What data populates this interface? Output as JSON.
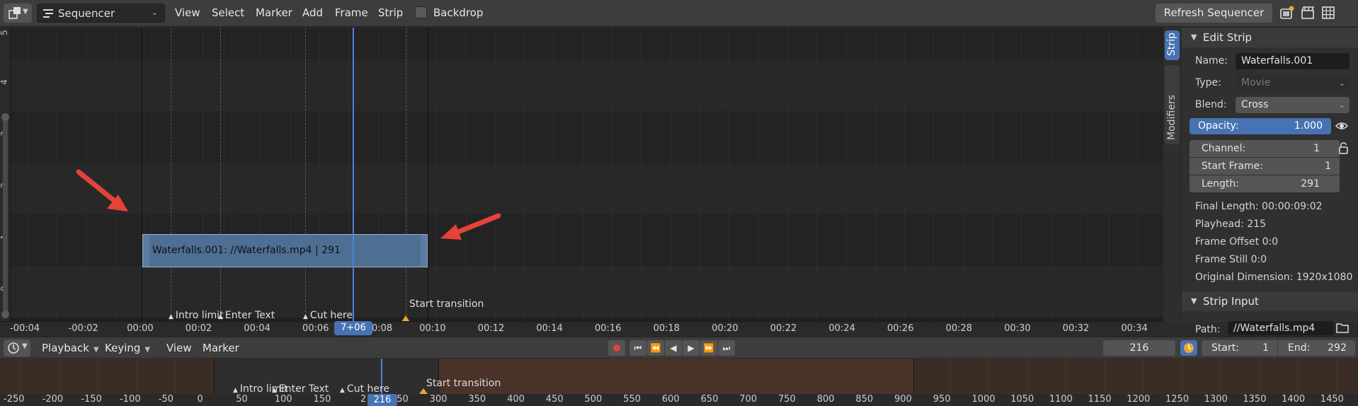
{
  "header": {
    "view_type": "Sequencer",
    "menus": [
      "View",
      "Select",
      "Marker",
      "Add",
      "Frame",
      "Strip"
    ],
    "backdrop_label": "Backdrop",
    "refresh_label": "Refresh Sequencer"
  },
  "sequencer": {
    "channels": [
      "5",
      "4",
      "3",
      "2",
      "1",
      "0"
    ],
    "strip_label": "Waterfalls.001: //Waterfalls.mp4 | 291",
    "markers": [
      "Intro limit",
      "Enter Text",
      "Cut here"
    ],
    "transition_marker": "Start transition",
    "time_labels": [
      "-00:04",
      "-00:02",
      "00:00",
      "00:02",
      "00:04",
      "00:06",
      "0:08",
      "00:10",
      "00:12",
      "00:14",
      "00:16",
      "00:18",
      "00:20",
      "00:22",
      "00:24",
      "00:26",
      "00:28",
      "00:30",
      "00:32",
      "00:34"
    ],
    "current_time": "7+06",
    "annotation_arrow_color": "#e5433a",
    "strip_color": "#4f6e93",
    "playhead_color": "#4c82d6"
  },
  "side_tabs": {
    "strip": "Strip",
    "modifiers": "Modifiers"
  },
  "edit_strip": {
    "title": "Edit Strip",
    "name_label": "Name:",
    "name_value": "Waterfalls.001",
    "type_label": "Type:",
    "type_value": "Movie",
    "blend_label": "Blend:",
    "blend_value": "Cross",
    "opacity_label": "Opacity:",
    "opacity_value": "1.000",
    "channel_label": "Channel:",
    "channel_value": "1",
    "start_frame_label": "Start Frame:",
    "start_frame_value": "1",
    "length_label": "Length:",
    "length_value": "291",
    "final_length": "Final Length: 00:00:09:02",
    "playhead": "Playhead: 215",
    "frame_offset": "Frame Offset 0:0",
    "frame_still": "Frame Still 0:0",
    "original_dimension": "Original Dimension: 1920x1080"
  },
  "strip_input": {
    "title": "Strip Input",
    "path_label": "Path:",
    "path_value": "//Waterfalls.mp4"
  },
  "timeline": {
    "playback_label": "Playback",
    "keying_label": "Keying",
    "view_label": "View",
    "marker_label": "Marker",
    "current_frame": "216",
    "start_label": "Start:",
    "start_value": "1",
    "end_label": "End:",
    "end_value": "292",
    "markers": [
      "Intro limit",
      "Enter Text",
      "Cut here"
    ],
    "transition_marker": "Start transition",
    "ruler_labels": [
      "-250",
      "-200",
      "-150",
      "-100",
      "-50",
      "0",
      "50",
      "100",
      "150",
      "2",
      "250",
      "300",
      "350",
      "400",
      "450",
      "500",
      "550",
      "600",
      "650",
      "700",
      "750",
      "800",
      "850",
      "900",
      "950",
      "1000",
      "1050",
      "1100",
      "1150",
      "1200",
      "1250",
      "1300",
      "1350",
      "1400",
      "1450"
    ],
    "ruler_current": "216"
  }
}
